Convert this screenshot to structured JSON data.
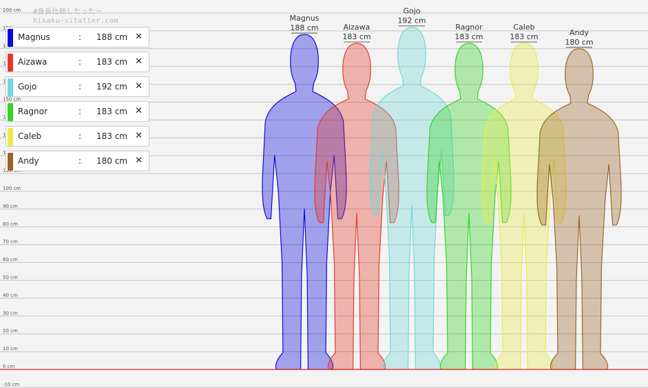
{
  "watermark": {
    "line1": "#身長比較したったー",
    "line2": "hikaku-sitatter.com"
  },
  "legend": [
    {
      "name": "Magnus",
      "sep": ":",
      "value": "188 cm",
      "close": "✕",
      "color": "#0a0adc"
    },
    {
      "name": "Aizawa",
      "sep": ":",
      "value": "183 cm",
      "close": "✕",
      "color": "#e53a2a"
    },
    {
      "name": "Gojo",
      "sep": ":",
      "value": "192 cm",
      "close": "✕",
      "color": "#6fd8d8"
    },
    {
      "name": "Ragnor",
      "sep": ":",
      "value": "183 cm",
      "close": "✕",
      "color": "#35d424"
    },
    {
      "name": "Caleb",
      "sep": ":",
      "value": "183 cm",
      "close": "✕",
      "color": "#e6eb4a"
    },
    {
      "name": "Andy",
      "sep": ":",
      "value": "180 cm",
      "close": "✕",
      "color": "#9a6424"
    }
  ],
  "chart_data": {
    "type": "bar",
    "title": "",
    "xlabel": "",
    "ylabel": "",
    "ylim": [
      -10,
      200
    ],
    "y_tick_labels": [
      "-10 cm",
      "0 cm",
      "10 cm",
      "20 cm",
      "30 cm",
      "40 cm",
      "50 cm",
      "60 cm",
      "70 cm",
      "80 cm",
      "90 cm",
      "100 cm",
      "110 cm",
      "120 cm",
      "130 cm",
      "140 cm",
      "150 cm",
      "160 cm",
      "170 cm",
      "180 cm",
      "190 cm",
      "200 cm"
    ],
    "y_ticks": [
      -10,
      0,
      10,
      20,
      30,
      40,
      50,
      60,
      70,
      80,
      90,
      100,
      110,
      120,
      130,
      140,
      150,
      160,
      170,
      180,
      190,
      200
    ],
    "baseline_color": "#dd2222",
    "categories": [
      "Magnus",
      "Aizawa",
      "Gojo",
      "Ragnor",
      "Caleb",
      "Andy"
    ],
    "values": [
      188,
      183,
      192,
      183,
      183,
      180
    ],
    "value_labels": [
      "188 cm",
      "183 cm",
      "192 cm",
      "183 cm",
      "183 cm",
      "180 cm"
    ],
    "colors": [
      "#0a0adc",
      "#e53a2a",
      "#6fd8d8",
      "#35d424",
      "#e6eb4a",
      "#9a6424"
    ]
  }
}
